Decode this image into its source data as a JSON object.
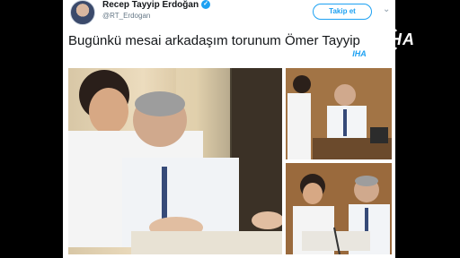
{
  "tweet": {
    "author_name": "Recep Tayyip Erdoğan",
    "verified_mark": "✓",
    "handle": "@RT_Erdogan",
    "follow_label": "Takip et",
    "menu_icon": "chevron-down-icon",
    "text": "Bugünkü mesai arkadaşım torunum Ömer Tayyip"
  },
  "photos": {
    "count": 3,
    "descriptions": [
      "photo-main",
      "photo-top-right",
      "photo-bottom-right"
    ]
  },
  "overlay": {
    "logo_text": "IHA",
    "small_logo_text": "IHA"
  },
  "colors": {
    "accent": "#1da1f2",
    "text": "#14171a",
    "muted": "#657786",
    "background": "#000000"
  }
}
